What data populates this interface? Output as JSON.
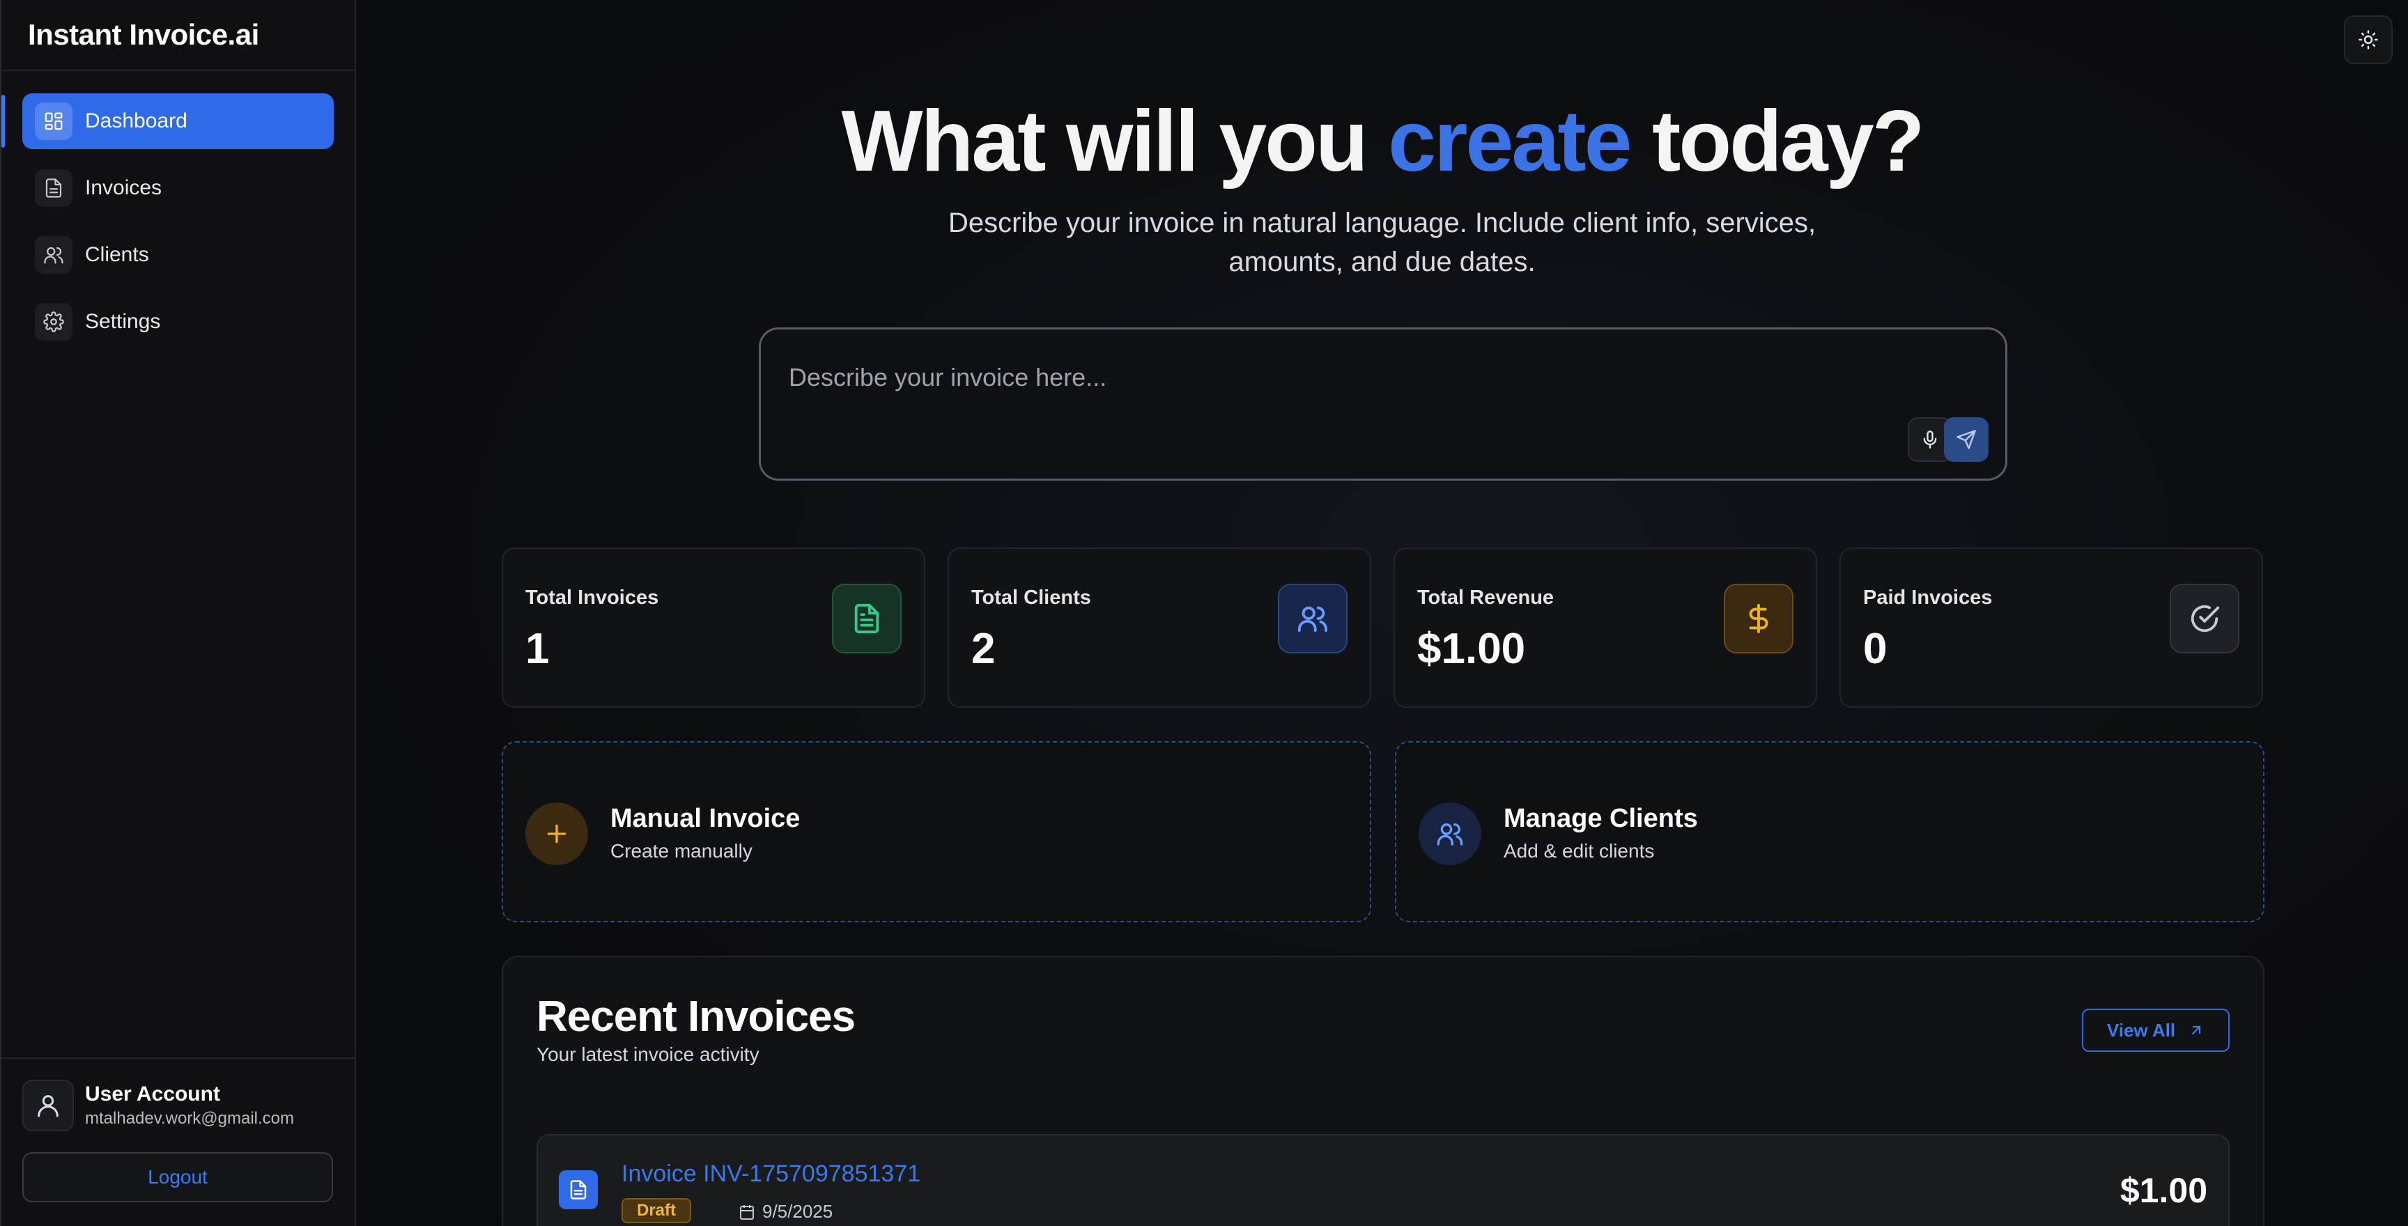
{
  "app": {
    "title": "Instant Invoice.ai"
  },
  "sidebar": {
    "items": [
      {
        "label": "Dashboard",
        "icon": "dashboard-icon",
        "active": true
      },
      {
        "label": "Invoices",
        "icon": "file-icon"
      },
      {
        "label": "Clients",
        "icon": "users-icon"
      },
      {
        "label": "Settings",
        "icon": "gear-icon"
      }
    ],
    "account": {
      "name": "User Account",
      "email": "mtalhadev.work@gmail.com"
    },
    "logout_label": "Logout"
  },
  "hero": {
    "title_before": "What will you ",
    "title_accent": "create",
    "title_after": " today?",
    "subtitle": "Describe your invoice in natural language. Include client info, services, amounts, and due dates.",
    "input_placeholder": "Describe your invoice here..."
  },
  "stats": [
    {
      "label": "Total Invoices",
      "value": "1",
      "icon": "file-text-icon",
      "color": "#37c98a"
    },
    {
      "label": "Total Clients",
      "value": "2",
      "icon": "users-icon",
      "color": "#6b9bff"
    },
    {
      "label": "Total Revenue",
      "value": "$1.00",
      "icon": "dollar-icon",
      "color": "#f1b21e"
    },
    {
      "label": "Paid Invoices",
      "value": "0",
      "icon": "check-circle-icon",
      "color": "#c9cbd0"
    }
  ],
  "actions": [
    {
      "title": "Manual Invoice",
      "subtitle": "Create manually",
      "icon": "plus-icon"
    },
    {
      "title": "Manage Clients",
      "subtitle": "Add & edit clients",
      "icon": "users-icon"
    }
  ],
  "recent": {
    "title": "Recent Invoices",
    "subtitle": "Your latest invoice activity",
    "view_all_label": "View All",
    "invoices": [
      {
        "title": "Invoice INV-1757097851371",
        "status": "Draft",
        "date": "9/5/2025",
        "amount": "$1.00"
      }
    ]
  },
  "colors": {
    "accent": "#2f6ae8",
    "background": "#0b0c0e",
    "draft": "#f0b73a"
  }
}
